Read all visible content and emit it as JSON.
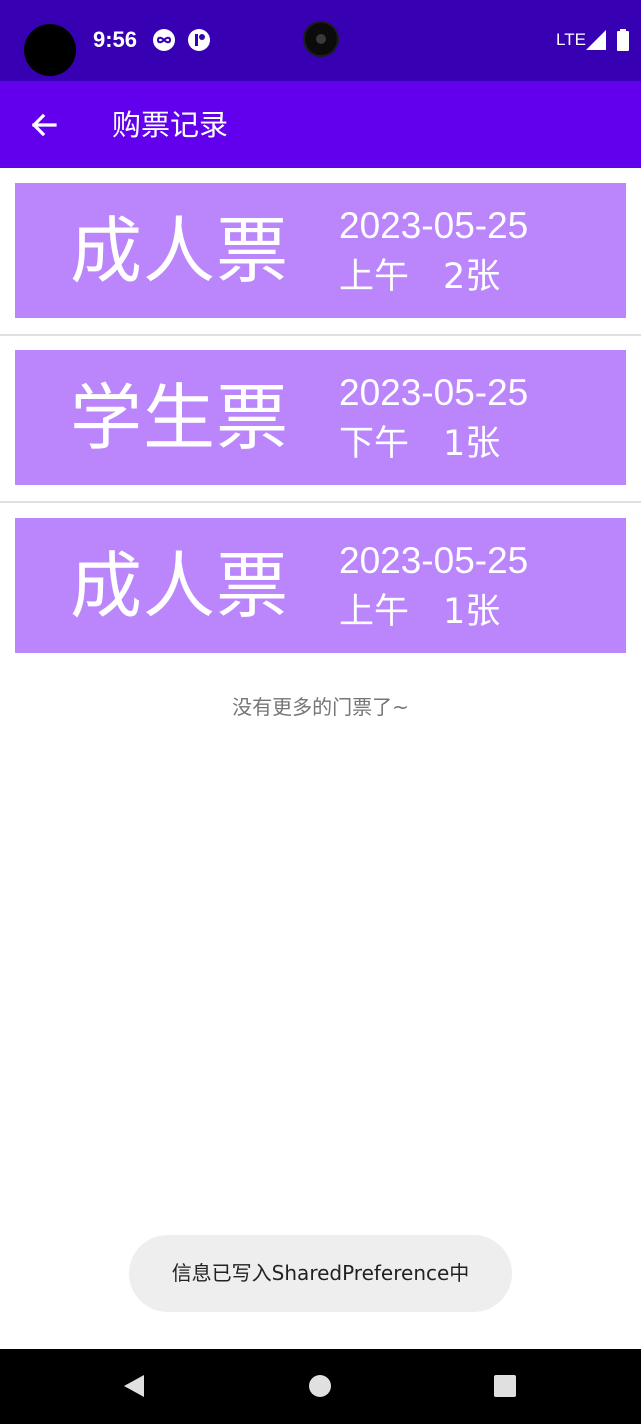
{
  "status_bar": {
    "time": "9:56",
    "network": "LTE",
    "icons": [
      "link-icon",
      "app-notification-icon",
      "signal-icon",
      "battery-icon"
    ]
  },
  "app_bar": {
    "title": "购票记录",
    "back_icon": "arrow-left-icon",
    "color": "#6200ee"
  },
  "tickets": [
    {
      "type": "成人票",
      "date": "2023-05-25",
      "period": "上午",
      "quantity": "2张"
    },
    {
      "type": "学生票",
      "date": "2023-05-25",
      "period": "下午",
      "quantity": "1张"
    },
    {
      "type": "成人票",
      "date": "2023-05-25",
      "period": "上午",
      "quantity": "1张"
    }
  ],
  "list_footer": "没有更多的门票了~",
  "toast": "信息已写入SharedPreference中",
  "colors": {
    "status_bar": "#3700b3",
    "card": "#bb86fc"
  },
  "nav_bar": {
    "icons": [
      "back-triangle-icon",
      "home-circle-icon",
      "recents-square-icon"
    ]
  }
}
